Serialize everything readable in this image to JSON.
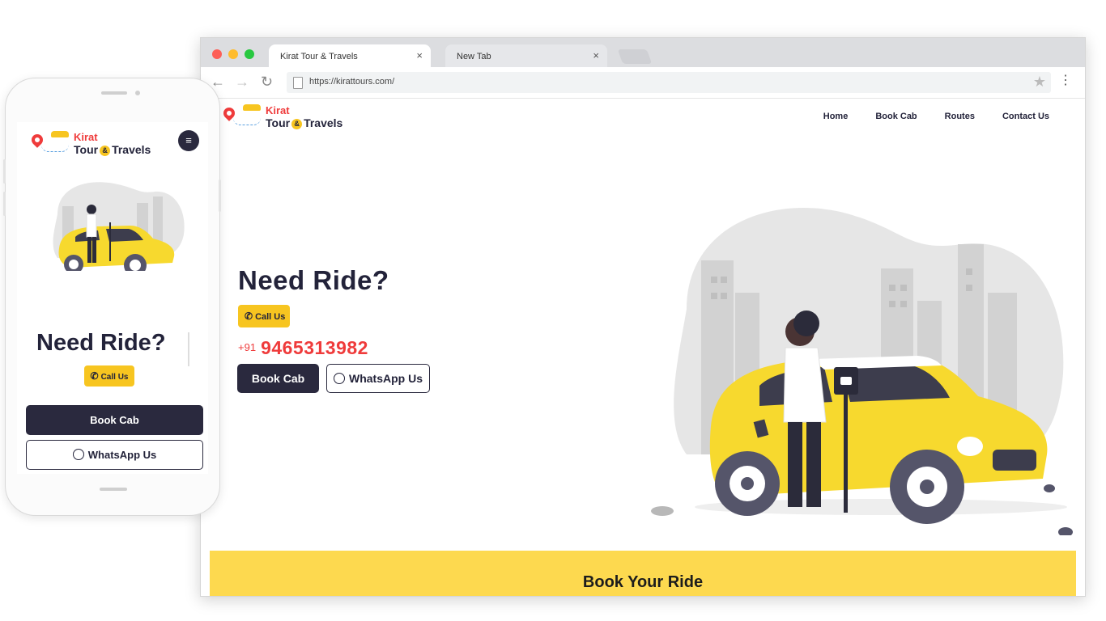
{
  "browser": {
    "tabs": [
      {
        "label": "Kirat Tour & Travels",
        "close": "×",
        "active": true
      },
      {
        "label": "New Tab",
        "close": "×",
        "active": false
      }
    ],
    "url": "https://kirattours.com/",
    "nav": {
      "back": "←",
      "forward": "→",
      "reload": "↻"
    },
    "star": "★",
    "menu": "⋮"
  },
  "site": {
    "logo": {
      "line1": "Kirat",
      "line2_a": "Tour",
      "amp": "&",
      "line2_b": "Travels"
    },
    "nav": [
      "Home",
      "Book Cab",
      "Routes",
      "Contact Us"
    ],
    "hero": {
      "title": "Need Ride?",
      "call_label": "Call Us",
      "country_code": "+91",
      "phone": "9465313982",
      "book_label": "Book Cab",
      "whatsapp_label": "WhatsApp Us"
    },
    "section": {
      "title": "Book Your Ride"
    }
  },
  "mobile": {
    "logo": {
      "line1": "Kirat",
      "line2_a": "Tour",
      "amp": "&",
      "line2_b": "Travels"
    },
    "menu_icon": "≡",
    "title": "Need Ride?",
    "call_label": "Call Us",
    "book_label": "Book Cab",
    "whatsapp_label": "WhatsApp Us"
  },
  "colors": {
    "brand_yellow": "#f7c520",
    "brand_red": "#ef3b3b",
    "brand_dark": "#2a293e",
    "band_yellow": "#fdd94f"
  },
  "icons": [
    "map-pin-icon",
    "taxi-icon",
    "phone-icon",
    "whatsapp-icon",
    "hamburger-icon",
    "star-icon",
    "kebab-menu-icon",
    "page-icon"
  ]
}
